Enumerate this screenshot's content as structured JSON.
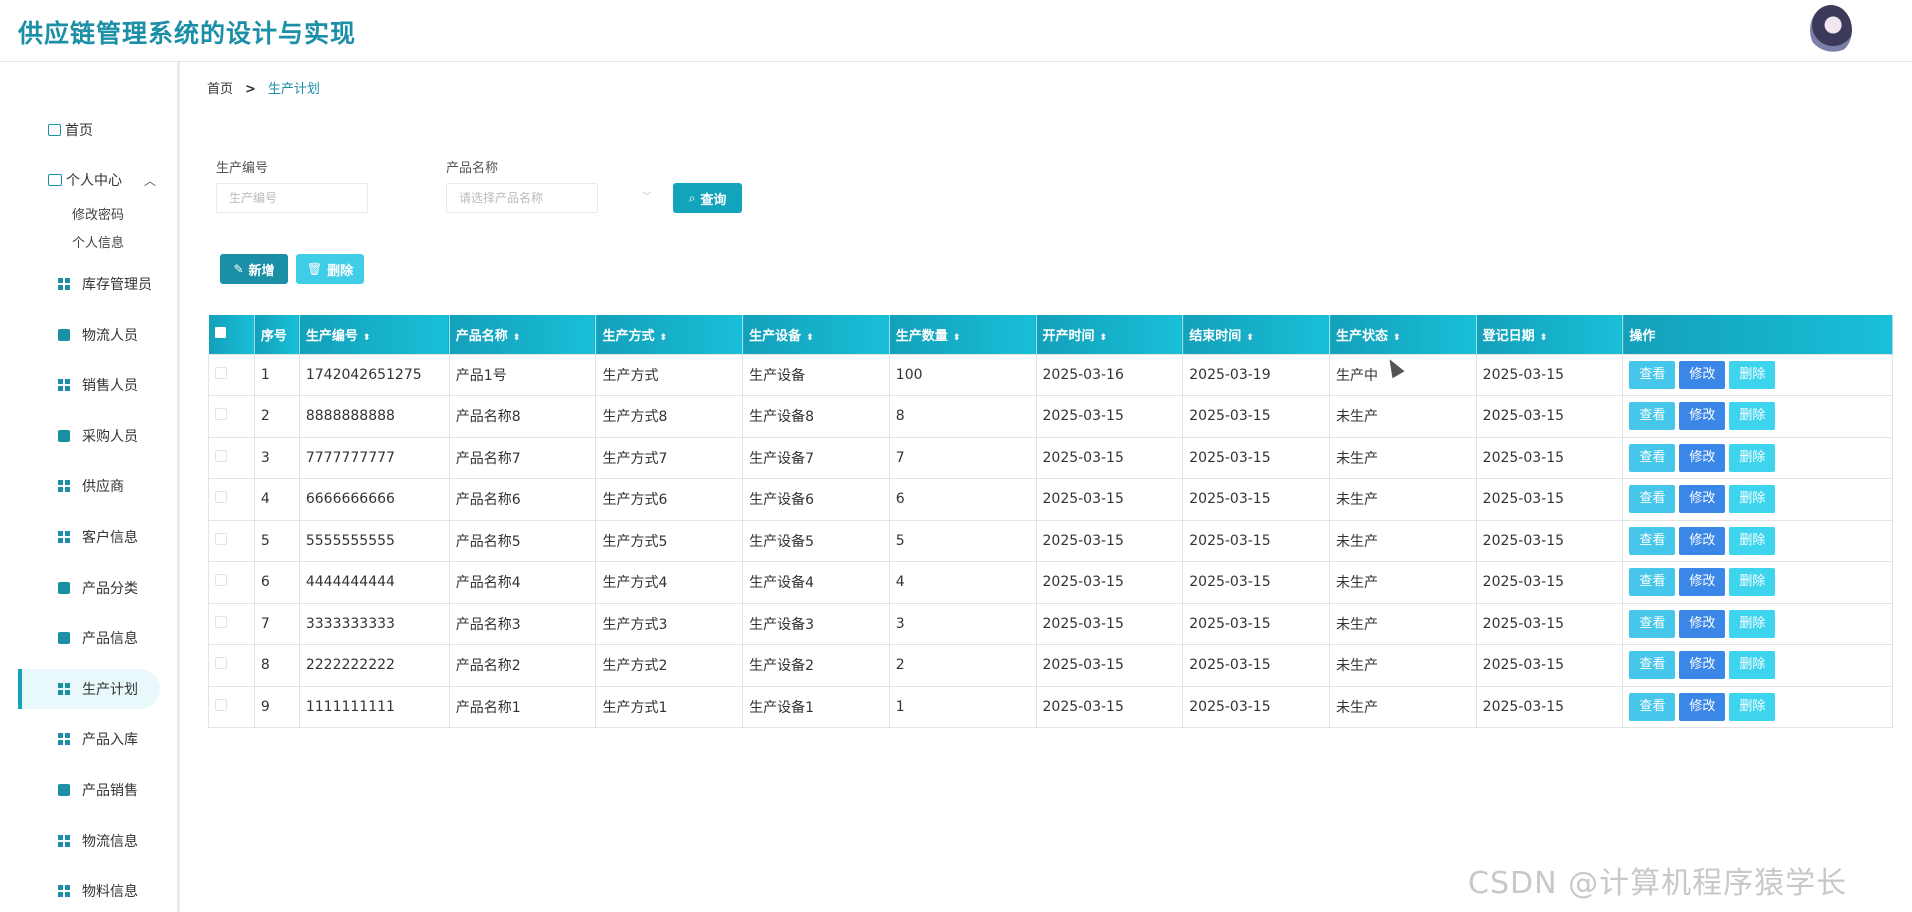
{
  "app": {
    "title": "供应链管理系统的设计与实现"
  },
  "sidebar": {
    "home": "首页",
    "personal": "个人中心",
    "personal_sub": [
      "修改密码",
      "个人信息"
    ],
    "items": [
      {
        "label": "库存管理员",
        "icon": "grid-icon"
      },
      {
        "label": "物流人员",
        "icon": "clipboard-icon"
      },
      {
        "label": "销售人员",
        "icon": "grid-icon"
      },
      {
        "label": "采购人员",
        "icon": "briefcase-icon"
      },
      {
        "label": "供应商",
        "icon": "grid-icon"
      },
      {
        "label": "客户信息",
        "icon": "grid-icon"
      },
      {
        "label": "产品分类",
        "icon": "clipboard-icon"
      },
      {
        "label": "产品信息",
        "icon": "monitor-icon"
      },
      {
        "label": "生产计划",
        "icon": "list-icon",
        "active": true
      },
      {
        "label": "产品入库",
        "icon": "grid-icon"
      },
      {
        "label": "产品销售",
        "icon": "flag-icon"
      },
      {
        "label": "物流信息",
        "icon": "grid-icon"
      },
      {
        "label": "物料信息",
        "icon": "grid-icon"
      }
    ]
  },
  "breadcrumb": {
    "home": "首页",
    "sep": ">",
    "current": "生产计划"
  },
  "search": {
    "code_label": "生产编号",
    "code_placeholder": "生产编号",
    "name_label": "产品名称",
    "name_placeholder": "请选择产品名称",
    "query_label": "查询"
  },
  "actions": {
    "add_label": "新增",
    "delete_label": "删除"
  },
  "table": {
    "headers": [
      "序号",
      "生产编号",
      "产品名称",
      "生产方式",
      "生产设备",
      "生产数量",
      "开产时间",
      "结束时间",
      "生产状态",
      "登记日期",
      "操作"
    ],
    "op_labels": {
      "view": "查看",
      "edit": "修改",
      "delete": "删除"
    },
    "rows": [
      [
        "1",
        "1742042651275",
        "产品1号",
        "生产方式",
        "生产设备",
        "100",
        "2025-03-16",
        "2025-03-19",
        "生产中",
        "2025-03-15"
      ],
      [
        "2",
        "8888888888",
        "产品名称8",
        "生产方式8",
        "生产设备8",
        "8",
        "2025-03-15",
        "2025-03-15",
        "未生产",
        "2025-03-15"
      ],
      [
        "3",
        "7777777777",
        "产品名称7",
        "生产方式7",
        "生产设备7",
        "7",
        "2025-03-15",
        "2025-03-15",
        "未生产",
        "2025-03-15"
      ],
      [
        "4",
        "6666666666",
        "产品名称6",
        "生产方式6",
        "生产设备6",
        "6",
        "2025-03-15",
        "2025-03-15",
        "未生产",
        "2025-03-15"
      ],
      [
        "5",
        "5555555555",
        "产品名称5",
        "生产方式5",
        "生产设备5",
        "5",
        "2025-03-15",
        "2025-03-15",
        "未生产",
        "2025-03-15"
      ],
      [
        "6",
        "4444444444",
        "产品名称4",
        "生产方式4",
        "生产设备4",
        "4",
        "2025-03-15",
        "2025-03-15",
        "未生产",
        "2025-03-15"
      ],
      [
        "7",
        "3333333333",
        "产品名称3",
        "生产方式3",
        "生产设备3",
        "3",
        "2025-03-15",
        "2025-03-15",
        "未生产",
        "2025-03-15"
      ],
      [
        "8",
        "2222222222",
        "产品名称2",
        "生产方式2",
        "生产设备2",
        "2",
        "2025-03-15",
        "2025-03-15",
        "未生产",
        "2025-03-15"
      ],
      [
        "9",
        "1111111111",
        "产品名称1",
        "生产方式1",
        "生产设备1",
        "1",
        "2025-03-15",
        "2025-03-15",
        "未生产",
        "2025-03-15"
      ]
    ]
  },
  "watermark": "CSDN @计算机程序猿学长",
  "colors": {
    "accent": "#1a8fa6",
    "header_bg": "#13a4bd",
    "edit": "#3b87e8",
    "view": "#45c6ea"
  }
}
